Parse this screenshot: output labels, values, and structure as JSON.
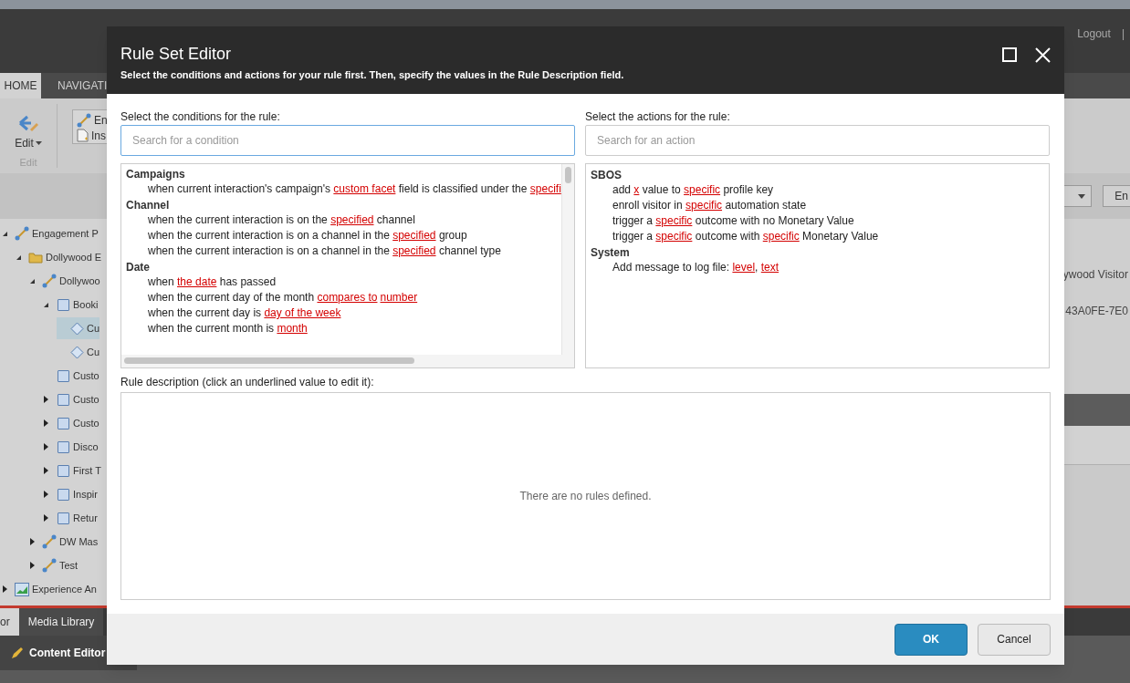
{
  "app": {
    "header_links": [
      "Logout",
      "|"
    ],
    "tabs": [
      {
        "label": "HOME",
        "selected": true
      },
      {
        "label": "NAVIGATI",
        "selected": false
      }
    ],
    "ribbon": {
      "edit_button": "Edit",
      "group_label": "Edit",
      "items": [
        {
          "label": "En",
          "kind": "plan"
        },
        {
          "label": "Ins",
          "kind": "insert"
        }
      ]
    },
    "tree": [
      {
        "label": "Engagement P",
        "kind": "plan",
        "has_children": true,
        "expanded": true,
        "selected": false,
        "children": [
          {
            "label": "Dollywood E",
            "kind": "folder",
            "has_children": true,
            "expanded": true,
            "selected": false,
            "children": [
              {
                "label": "Dollywoo",
                "kind": "plan",
                "has_children": true,
                "expanded": true,
                "selected": false,
                "children": [
                  {
                    "label": "Booki",
                    "kind": "state",
                    "has_children": true,
                    "expanded": true,
                    "selected": false,
                    "children": [
                      {
                        "label": "Cu",
                        "kind": "condition",
                        "has_children": false,
                        "selected": true
                      },
                      {
                        "label": "Cu",
                        "kind": "condition",
                        "has_children": false,
                        "selected": false
                      }
                    ]
                  },
                  {
                    "label": "Custo",
                    "kind": "state",
                    "has_children": false,
                    "selected": false
                  },
                  {
                    "label": "Custo",
                    "kind": "state",
                    "has_children": true,
                    "expanded": false,
                    "selected": false
                  },
                  {
                    "label": "Custo",
                    "kind": "state",
                    "has_children": true,
                    "expanded": false,
                    "selected": false
                  },
                  {
                    "label": "Disco",
                    "kind": "state",
                    "has_children": true,
                    "expanded": false,
                    "selected": false
                  },
                  {
                    "label": "First T",
                    "kind": "state",
                    "has_children": true,
                    "expanded": false,
                    "selected": false
                  },
                  {
                    "label": "Inspir",
                    "kind": "state",
                    "has_children": true,
                    "expanded": false,
                    "selected": false
                  },
                  {
                    "label": "Retur",
                    "kind": "state",
                    "has_children": true,
                    "expanded": false,
                    "selected": false
                  }
                ]
              },
              {
                "label": "DW Mas",
                "kind": "plan",
                "has_children": true,
                "expanded": false,
                "selected": false
              },
              {
                "label": "Test",
                "kind": "plan",
                "has_children": true,
                "expanded": false,
                "selected": false
              }
            ]
          }
        ]
      },
      {
        "label": "Experience An",
        "kind": "chart",
        "has_children": true,
        "expanded": false,
        "selected": false
      }
    ],
    "right_panel": {
      "button": "En",
      "texts": [
        "ywood Visitor",
        "43A0FE-7E0"
      ]
    },
    "bottom_tabs": [
      {
        "label": "or",
        "selected": true
      },
      {
        "label": "Media Library",
        "selected": false
      }
    ],
    "status_title": "Content Editor"
  },
  "dialog": {
    "title": "Rule Set Editor",
    "subtitle": "Select the conditions and actions for your rule first. Then, specify the values in the Rule Description field.",
    "conditions_label": "Select the conditions for the rule:",
    "conditions_search": {
      "placeholder": "Search for a condition"
    },
    "conditions": [
      {
        "category": "Campaigns",
        "items": [
          [
            {
              "text": "when current interaction's campaign's ",
              "kind": "text"
            },
            {
              "text": "custom facet",
              "kind": "link"
            },
            {
              "text": " field is classified under the ",
              "kind": "text"
            },
            {
              "text": "specifi",
              "kind": "link"
            }
          ]
        ]
      },
      {
        "category": "Channel",
        "items": [
          [
            {
              "text": "when the current interaction is on the ",
              "kind": "text"
            },
            {
              "text": "specified",
              "kind": "link"
            },
            {
              "text": " channel",
              "kind": "text"
            }
          ],
          [
            {
              "text": "when the current interaction is on a channel in the ",
              "kind": "text"
            },
            {
              "text": "specified",
              "kind": "link"
            },
            {
              "text": " group",
              "kind": "text"
            }
          ],
          [
            {
              "text": "when the current interaction is on a channel in the ",
              "kind": "text"
            },
            {
              "text": "specified",
              "kind": "link"
            },
            {
              "text": " channel type",
              "kind": "text"
            }
          ]
        ]
      },
      {
        "category": "Date",
        "items": [
          [
            {
              "text": "when ",
              "kind": "text"
            },
            {
              "text": "the date",
              "kind": "link"
            },
            {
              "text": " has passed",
              "kind": "text"
            }
          ],
          [
            {
              "text": "when the current day of the month ",
              "kind": "text"
            },
            {
              "text": "compares to",
              "kind": "link"
            },
            {
              "text": "number",
              "kind": "link"
            }
          ],
          [
            {
              "text": "when the current day is ",
              "kind": "text"
            },
            {
              "text": "day of the week",
              "kind": "link"
            }
          ],
          [
            {
              "text": "when the current month is ",
              "kind": "text"
            },
            {
              "text": "month",
              "kind": "link"
            }
          ]
        ]
      }
    ],
    "actions_label": "Select the actions for the rule:",
    "actions_search": {
      "placeholder": "Search for an action"
    },
    "actions": [
      {
        "category": "SBOS",
        "items": [
          [
            {
              "text": "add ",
              "kind": "text"
            },
            {
              "text": "x",
              "kind": "link"
            },
            {
              "text": " value to ",
              "kind": "text"
            },
            {
              "text": "specific",
              "kind": "link"
            },
            {
              "text": " profile key",
              "kind": "text"
            }
          ],
          [
            {
              "text": "enroll visitor in ",
              "kind": "text"
            },
            {
              "text": "specific",
              "kind": "link"
            },
            {
              "text": " automation state",
              "kind": "text"
            }
          ],
          [
            {
              "text": "trigger a ",
              "kind": "text"
            },
            {
              "text": "specific",
              "kind": "link"
            },
            {
              "text": " outcome with no Monetary Value",
              "kind": "text"
            }
          ],
          [
            {
              "text": "trigger a ",
              "kind": "text"
            },
            {
              "text": "specific",
              "kind": "link"
            },
            {
              "text": " outcome with ",
              "kind": "text"
            },
            {
              "text": "specific",
              "kind": "link"
            },
            {
              "text": " Monetary Value",
              "kind": "text"
            }
          ]
        ]
      },
      {
        "category": "System",
        "items": [
          [
            {
              "text": "Add message to log file: ",
              "kind": "text"
            },
            {
              "text": "level",
              "kind": "link"
            },
            {
              "text": ", ",
              "kind": "text"
            },
            {
              "text": "text",
              "kind": "link"
            }
          ]
        ]
      }
    ],
    "description_label": "Rule description (click an underlined value to edit it):",
    "description_empty": "There are no rules defined.",
    "buttons": [
      {
        "label": "OK",
        "kind": "primary"
      },
      {
        "label": "Cancel",
        "kind": "secondary"
      }
    ]
  }
}
